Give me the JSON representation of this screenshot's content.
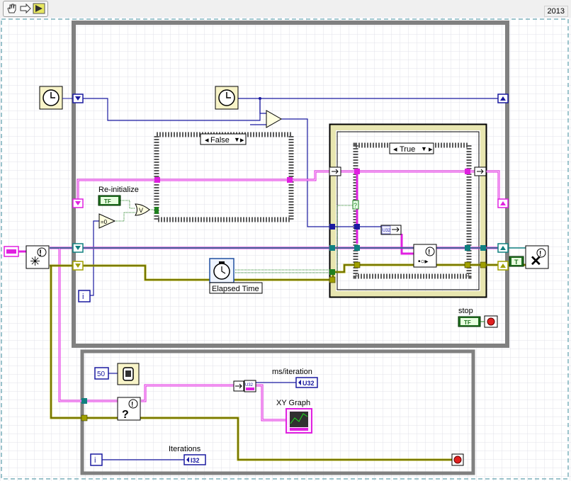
{
  "toolbar": {
    "version": "2013",
    "buttons": [
      "hand-tool-icon",
      "forward-arrow-icon",
      "run-arrow-icon"
    ]
  },
  "case_top": {
    "selector": "False"
  },
  "case_inner": {
    "selector": "True"
  },
  "labels": {
    "reinitialize": "Re-initialize",
    "elapsed_time": "Elapsed Time",
    "stop": "stop",
    "ms_iteration": "ms/iteration",
    "xy_graph": "XY Graph",
    "iterations": "Iterations"
  },
  "terminals": {
    "tf": "TF",
    "u32": "U32",
    "i32": "I32",
    "iteration": "i",
    "wait_ms": "50",
    "or": "V",
    "equal_zero": "=0",
    "t_const": "T",
    "selector_arrow": "▼"
  },
  "colors": {
    "background": "#ffffff",
    "grid": "#e2e2ea",
    "loop_frame": "#808080",
    "case_frame": "#5a5a5a",
    "wire_blue": "#1a1aa0",
    "wire_pink": "#e020e0",
    "wire_teal": "#108080",
    "wire_olive": "#a0a000",
    "wire_green": "#208020"
  }
}
